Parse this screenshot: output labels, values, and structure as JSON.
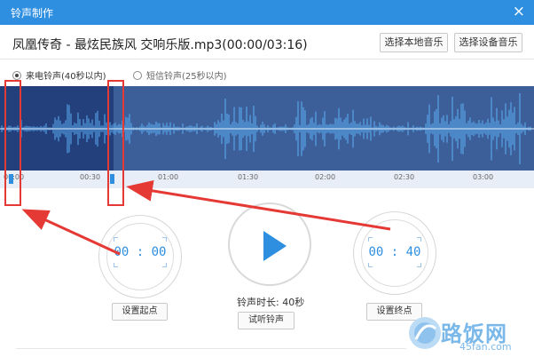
{
  "window": {
    "title": "铃声制作",
    "close_glyph": "×"
  },
  "file": {
    "name": "凤凰传奇 - 最炫民族风 交响乐版.mp3(00:00/03:16)",
    "select_local_label": "选择本地音乐",
    "select_device_label": "选择设备音乐"
  },
  "ringtone_type": {
    "selected": "call",
    "options": [
      {
        "id": "call",
        "label": "来电铃声(40秒以内)"
      },
      {
        "id": "sms",
        "label": "短信铃声(25秒以内)"
      }
    ]
  },
  "timeline": {
    "total_seconds": 196,
    "ticks": [
      "00:00",
      "00:30",
      "01:00",
      "01:30",
      "02:00",
      "02:30",
      "03:00"
    ],
    "selection_start_seconds": 0,
    "selection_end_seconds": 40
  },
  "controls": {
    "start_time": "00 : 00",
    "end_time": "00 : 40",
    "duration_text": "铃声时长: 40秒",
    "set_start_label": "设置起点",
    "set_end_label": "设置终点",
    "preview_label": "试听铃声"
  },
  "watermark": {
    "text": "路饭网",
    "url": "45fan.com"
  },
  "colors": {
    "accent": "#2e8fe0",
    "wave_bg": "#3c5f9a",
    "wave_selected": "#233f7c",
    "annotation": "#e53935"
  }
}
